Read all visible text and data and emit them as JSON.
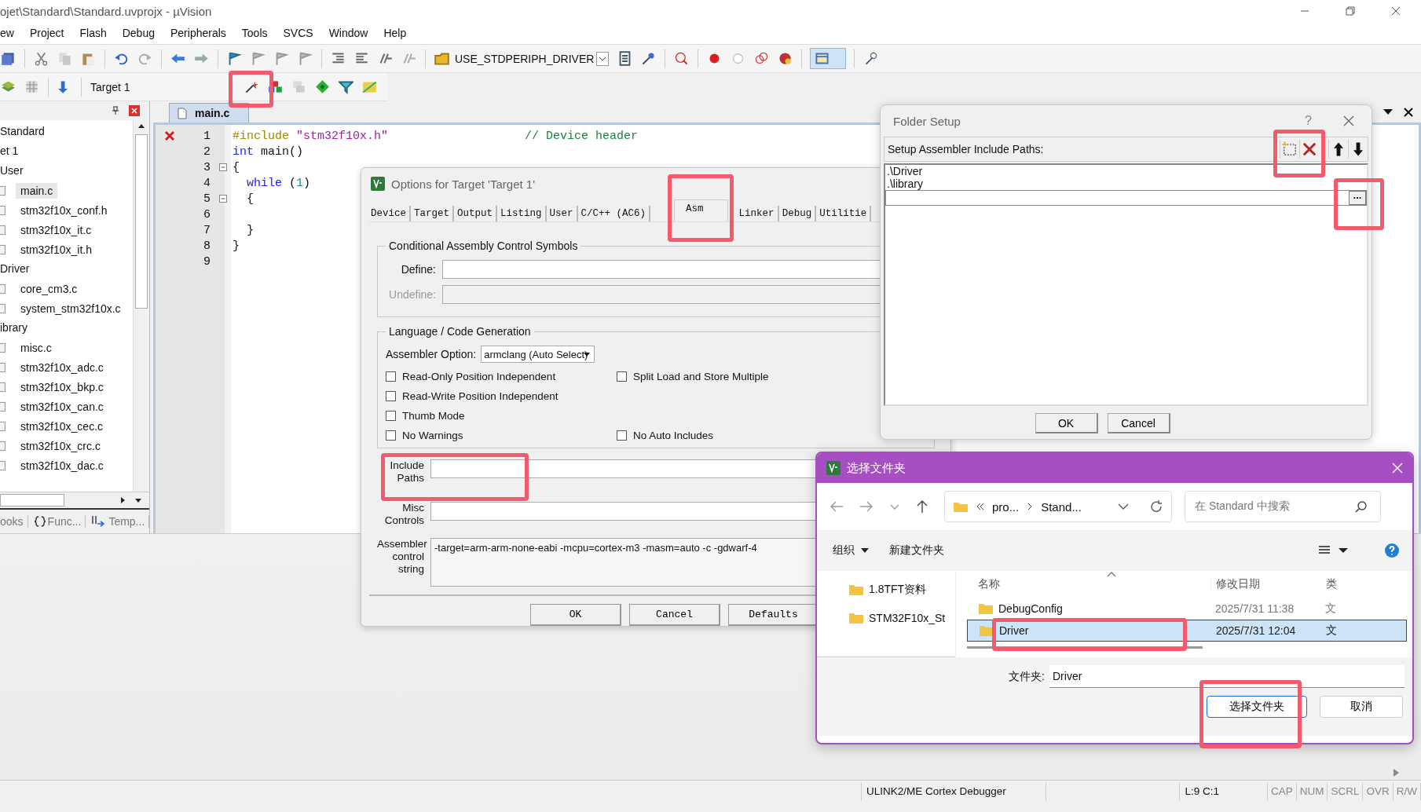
{
  "window": {
    "title": "ojet\\Standard\\Standard.uvprojx - µVision"
  },
  "menu": [
    "ew",
    "Project",
    "Flash",
    "Debug",
    "Peripherals",
    "Tools",
    "SVCS",
    "Window",
    "Help"
  ],
  "toolbar": {
    "define_combo": "USE_STDPERIPH_DRIVER",
    "target_combo": "Target 1"
  },
  "project": {
    "tree": [
      {
        "label": "Standard",
        "children": [
          {
            "label": "et 1",
            "children": [
              {
                "label": "User",
                "children": [
                  {
                    "label": "main.c",
                    "selected": true
                  },
                  {
                    "label": "stm32f10x_conf.h",
                    "selected": false
                  },
                  {
                    "label": "stm32f10x_it.c",
                    "selected": false
                  },
                  {
                    "label": "stm32f10x_it.h",
                    "selected": false
                  }
                ]
              },
              {
                "label": "Driver",
                "children": [
                  {
                    "label": "core_cm3.c",
                    "selected": false
                  },
                  {
                    "label": "system_stm32f10x.c",
                    "selected": false
                  }
                ]
              },
              {
                "label": "ibrary",
                "children": [
                  {
                    "label": "misc.c",
                    "selected": false
                  },
                  {
                    "label": "stm32f10x_adc.c",
                    "selected": false
                  },
                  {
                    "label": "stm32f10x_bkp.c",
                    "selected": false
                  },
                  {
                    "label": "stm32f10x_can.c",
                    "selected": false
                  },
                  {
                    "label": "stm32f10x_cec.c",
                    "selected": false
                  },
                  {
                    "label": "stm32f10x_crc.c",
                    "selected": false
                  },
                  {
                    "label": "stm32f10x_dac.c",
                    "selected": false
                  }
                ]
              }
            ]
          }
        ]
      }
    ],
    "tabs": [
      {
        "label": "ooks",
        "kind": "books"
      },
      {
        "label": "Func...",
        "kind": "functions"
      },
      {
        "label": "Temp...",
        "kind": "templates"
      }
    ]
  },
  "editor": {
    "tab": "main.c",
    "lines": [
      {
        "n": "1",
        "error": true,
        "fold_box": false,
        "code": [
          {
            "kind": "directive",
            "text": "#include"
          },
          {
            "kind": "string",
            "text": "\"stm32f10x.h\""
          },
          {
            "kind": "comment",
            "text": "// Device header"
          }
        ]
      },
      {
        "n": "2",
        "error": false,
        "fold_box": false,
        "code": [
          {
            "kind": "keyword",
            "text": "int"
          },
          {
            "kind": "plain",
            "text": "main()"
          }
        ]
      },
      {
        "n": "3",
        "error": false,
        "fold_box": true,
        "code": [
          {
            "kind": "plain",
            "text": "{"
          }
        ]
      },
      {
        "n": "4",
        "error": false,
        "fold_box": false,
        "code": [
          {
            "kind": "keyword",
            "text": "  while"
          },
          {
            "kind": "plain",
            "text": "("
          },
          {
            "kind": "number",
            "text": "1"
          },
          {
            "kind": "plain",
            "text": ")"
          }
        ]
      },
      {
        "n": "5",
        "error": false,
        "fold_box": true,
        "code": [
          {
            "kind": "plain",
            "text": "  {"
          }
        ]
      },
      {
        "n": "6",
        "error": false,
        "fold_box": false
      },
      {
        "n": "7",
        "error": false,
        "fold_box": false,
        "code": [
          {
            "kind": "plain",
            "text": "  }"
          }
        ]
      },
      {
        "n": "8",
        "error": false,
        "fold_box": false,
        "code": [
          {
            "kind": "plain",
            "text": "}"
          }
        ]
      },
      {
        "n": "9",
        "error": false,
        "fold_box": false
      }
    ]
  },
  "options_dialog": {
    "title": "Options for Target 'Target 1'",
    "tabs": [
      {
        "label": "Device",
        "selected": false
      },
      {
        "label": "Target",
        "selected": false
      },
      {
        "label": "Output",
        "selected": false
      },
      {
        "label": "Listing",
        "selected": false
      },
      {
        "label": "User",
        "selected": false
      },
      {
        "label": "C/C++ (AC6)",
        "selected": false
      },
      {
        "label": "Asm",
        "selected": true
      },
      {
        "label": "Linker",
        "selected": false
      },
      {
        "label": "Debug",
        "selected": false
      },
      {
        "label": "Utilitie",
        "selected": false
      }
    ],
    "symbols_group": {
      "title": "Conditional Assembly Control Symbols",
      "define_label": "Define:",
      "undefine_label": "Undefine:",
      "undefine_disabled": true
    },
    "language_group": {
      "title": "Language / Code Generation",
      "option_label": "Assembler Option:",
      "option_value": "armclang (Auto Select)",
      "checkbox_rows": [
        [
          {
            "label": "Read-Only Position Independent",
            "checked": false
          },
          {
            "label": "Split Load and Store Multiple",
            "checked": false
          }
        ],
        [
          {
            "label": "Read-Write Position Independent",
            "checked": false
          }
        ],
        [
          {
            "label": "Thumb Mode",
            "checked": false
          }
        ],
        [
          {
            "label": "No Warnings",
            "checked": false
          },
          {
            "label": "No Auto Includes",
            "checked": false
          }
        ]
      ]
    },
    "include_label": "Include Paths",
    "misc_label": "Misc Controls",
    "control_label": "Assembler control string",
    "control_string": "-target=arm-arm-none-eabi -mcpu=cortex-m3 -masm=auto -c -gdwarf-4",
    "buttons": [
      "OK",
      "Cancel",
      "Defaults"
    ]
  },
  "folder_setup": {
    "title": "Folder Setup",
    "help": "?",
    "list_label": "Setup Assembler Include Paths:",
    "paths": [
      ".\\Driver",
      ".\\library"
    ],
    "browse": "...",
    "buttons": [
      "OK",
      "Cancel"
    ]
  },
  "folder_picker": {
    "title": "选择文件夹",
    "breadcrumb": [
      "pro...",
      "Stand..."
    ],
    "search_placeholder": "在 Standard 中搜索",
    "organize": "组织",
    "new_folder": "新建文件夹",
    "nav_items": [
      "1.8TFT资料",
      "STM32F10x_St"
    ],
    "columns": [
      "名称",
      "修改日期",
      "类"
    ],
    "rows": [
      {
        "name": "DebugConfig",
        "date": "2025/7/31 11:38",
        "type": "文",
        "selected": false
      },
      {
        "name": "Driver",
        "date": "2025/7/31 12:04",
        "type": "文",
        "selected": true
      }
    ],
    "folder_label": "文件夹:",
    "folder_value": "Driver",
    "buttons": [
      "选择文件夹",
      "取消"
    ]
  },
  "status_bar": {
    "fields": [
      "ULINK2/ME Cortex Debugger",
      "L:9 C:1"
    ],
    "indicators": [
      {
        "label": "CAP",
        "on": false
      },
      {
        "label": "NUM",
        "on": false
      },
      {
        "label": "SCRL",
        "on": false
      },
      {
        "label": "OVR",
        "on": false
      },
      {
        "label": "R/W",
        "on": false
      }
    ]
  }
}
